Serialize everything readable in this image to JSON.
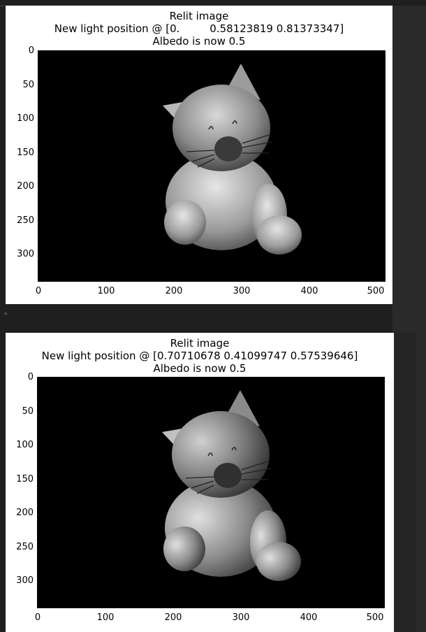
{
  "figures": [
    {
      "title_line1": "Relit image",
      "title_line2": "New light position @ [0.         0.58123819 0.81373347]",
      "title_line3": "Albedo is now 0.5"
    },
    {
      "title_line1": "Relit image",
      "title_line2": "New light position @ [0.70710678 0.41099747 0.57539646]",
      "title_line3": "Albedo is now 0.5"
    }
  ],
  "axes": {
    "y_ticks": [
      "0",
      "50",
      "100",
      "150",
      "200",
      "250",
      "300"
    ],
    "x_ticks": [
      "0",
      "100",
      "200",
      "300",
      "400",
      "500"
    ]
  },
  "image_subject": "grayscale cat figurine on black background",
  "colors": {
    "figure_bg": "#ffffff",
    "image_bg": "#000000",
    "page_bg": "#1f1f1f"
  }
}
